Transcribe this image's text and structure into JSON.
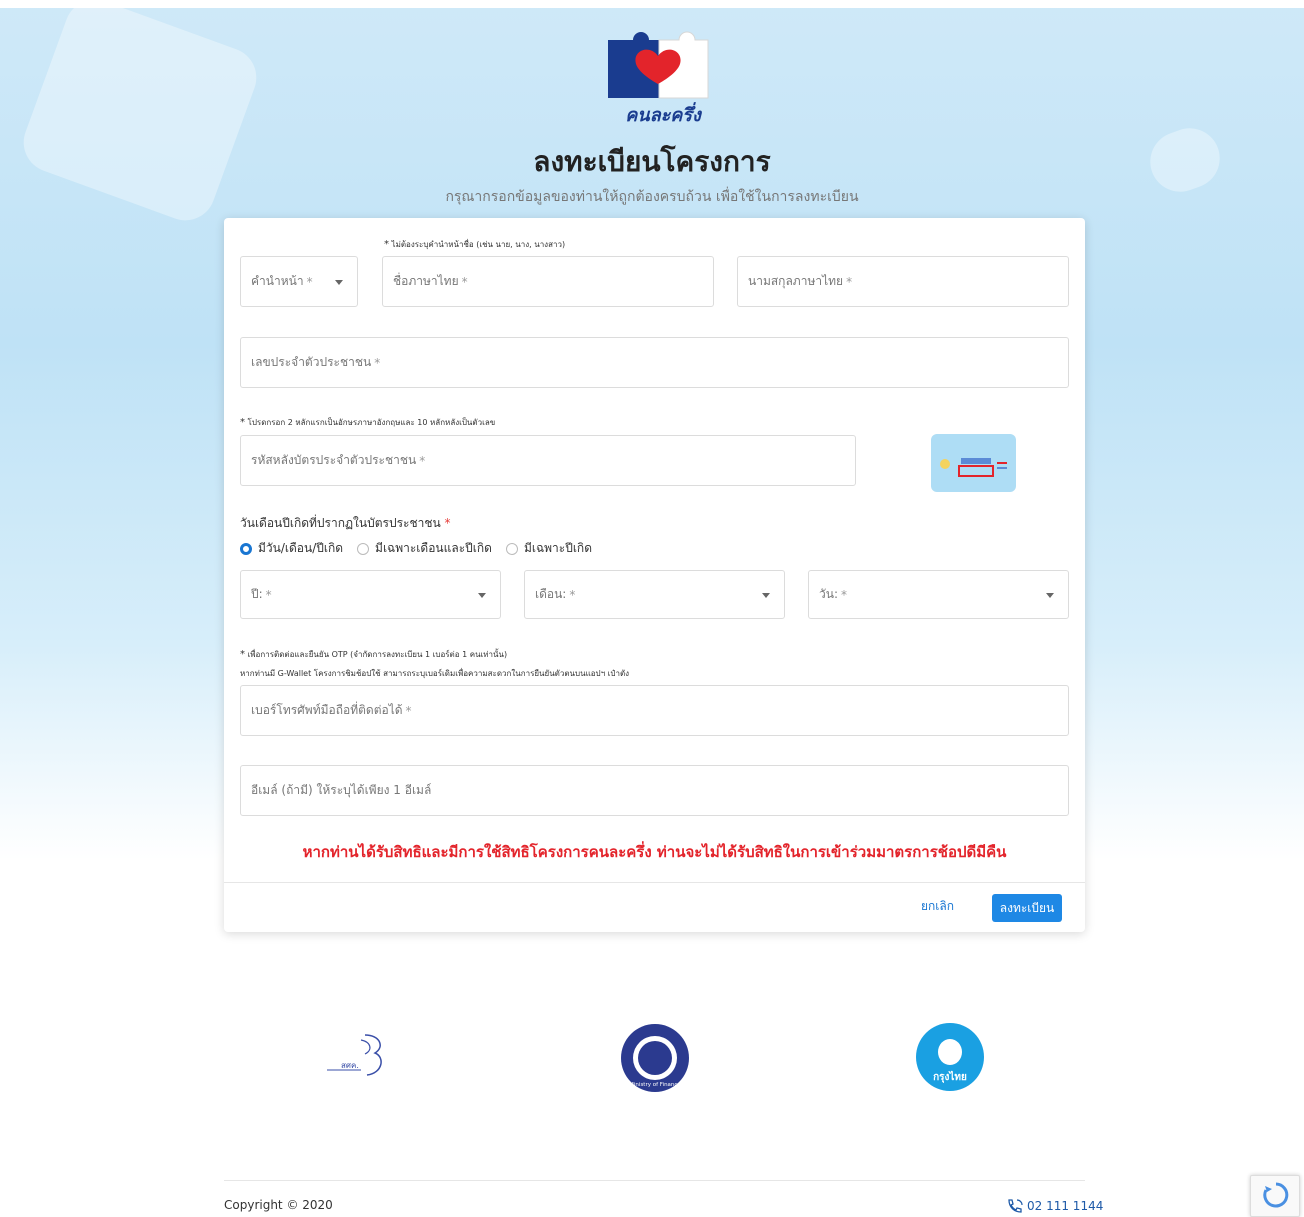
{
  "brand": {
    "logo_text": "คนละครึ่ง"
  },
  "header": {
    "title": "ลงทะเบียนโครงการ",
    "subtitle": "กรุณากรอกข้อมูลของท่านให้ถูกต้องครบถ้วน เพื่อใช้ในการลงทะเบียน"
  },
  "form": {
    "name_hint": "ไม่ต้องระบุคำนำหน้าชื่อ (เช่น นาย, นาง, นางสาว)",
    "prefix_placeholder": "คำนำหน้า",
    "first_name_placeholder": "ชื่อภาษาไทย",
    "last_name_placeholder": "นามสกุลภาษาไทย",
    "citizen_id_placeholder": "เลขประจำตัวประชาชน",
    "laser_hint": "โปรดกรอก 2 หลักแรกเป็นอักษรภาษาอังกฤษและ 10 หลักหลังเป็นตัวเลข",
    "laser_placeholder": "รหัสหลังบัตรประจำตัวประชาชน",
    "dob_label": "วันเดือนปีเกิดที่ปรากฏในบัตรประชาชน",
    "dob_options": [
      "มีวัน/เดือน/ปีเกิด",
      "มีเฉพาะเดือนและปีเกิด",
      "มีเฉพาะปีเกิด"
    ],
    "dob_selected_index": 0,
    "year_placeholder": "ปี:",
    "month_placeholder": "เดือน:",
    "day_placeholder": "วัน:",
    "phone_hint": "เพื่อการติดต่อและยืนยัน OTP (จำกัดการลงทะเบียน 1 เบอร์ต่อ 1 คนเท่านั้น)",
    "phone_hint_2": "หากท่านมี G-Wallet โครงการชิมช้อปใช้ สามารถระบุเบอร์เดิมเพื่อความสะดวกในการยืนยันตัวตนบนแอปฯ เป๋าตัง",
    "phone_placeholder": "เบอร์โทรศัพท์มือถือที่ติดต่อได้",
    "email_placeholder": "อีเมล์ (ถ้ามี) ให้ระบุได้เพียง 1 อีเมล์",
    "required_mark": "*"
  },
  "warning": "หากท่านได้รับสิทธิและมีการใช้สิทธิโครงการคนละครึ่ง ท่านจะไม่ได้รับสิทธิในการเข้าร่วมมาตรการช้อปดีมีคืน",
  "actions": {
    "cancel_label": "ยกเลิก",
    "submit_label": "ลงทะเบียน"
  },
  "footer_logos": {
    "left_text": "สศค.",
    "middle_text": "Ministry of Finance",
    "right_text": "กรุงไทย"
  },
  "footer": {
    "copyright": "Copyright © 2020",
    "phone": "02 111 1144"
  },
  "colors": {
    "primary": "#1e88e5",
    "warning": "#e3242b",
    "brand_navy": "#1a3c8f"
  }
}
